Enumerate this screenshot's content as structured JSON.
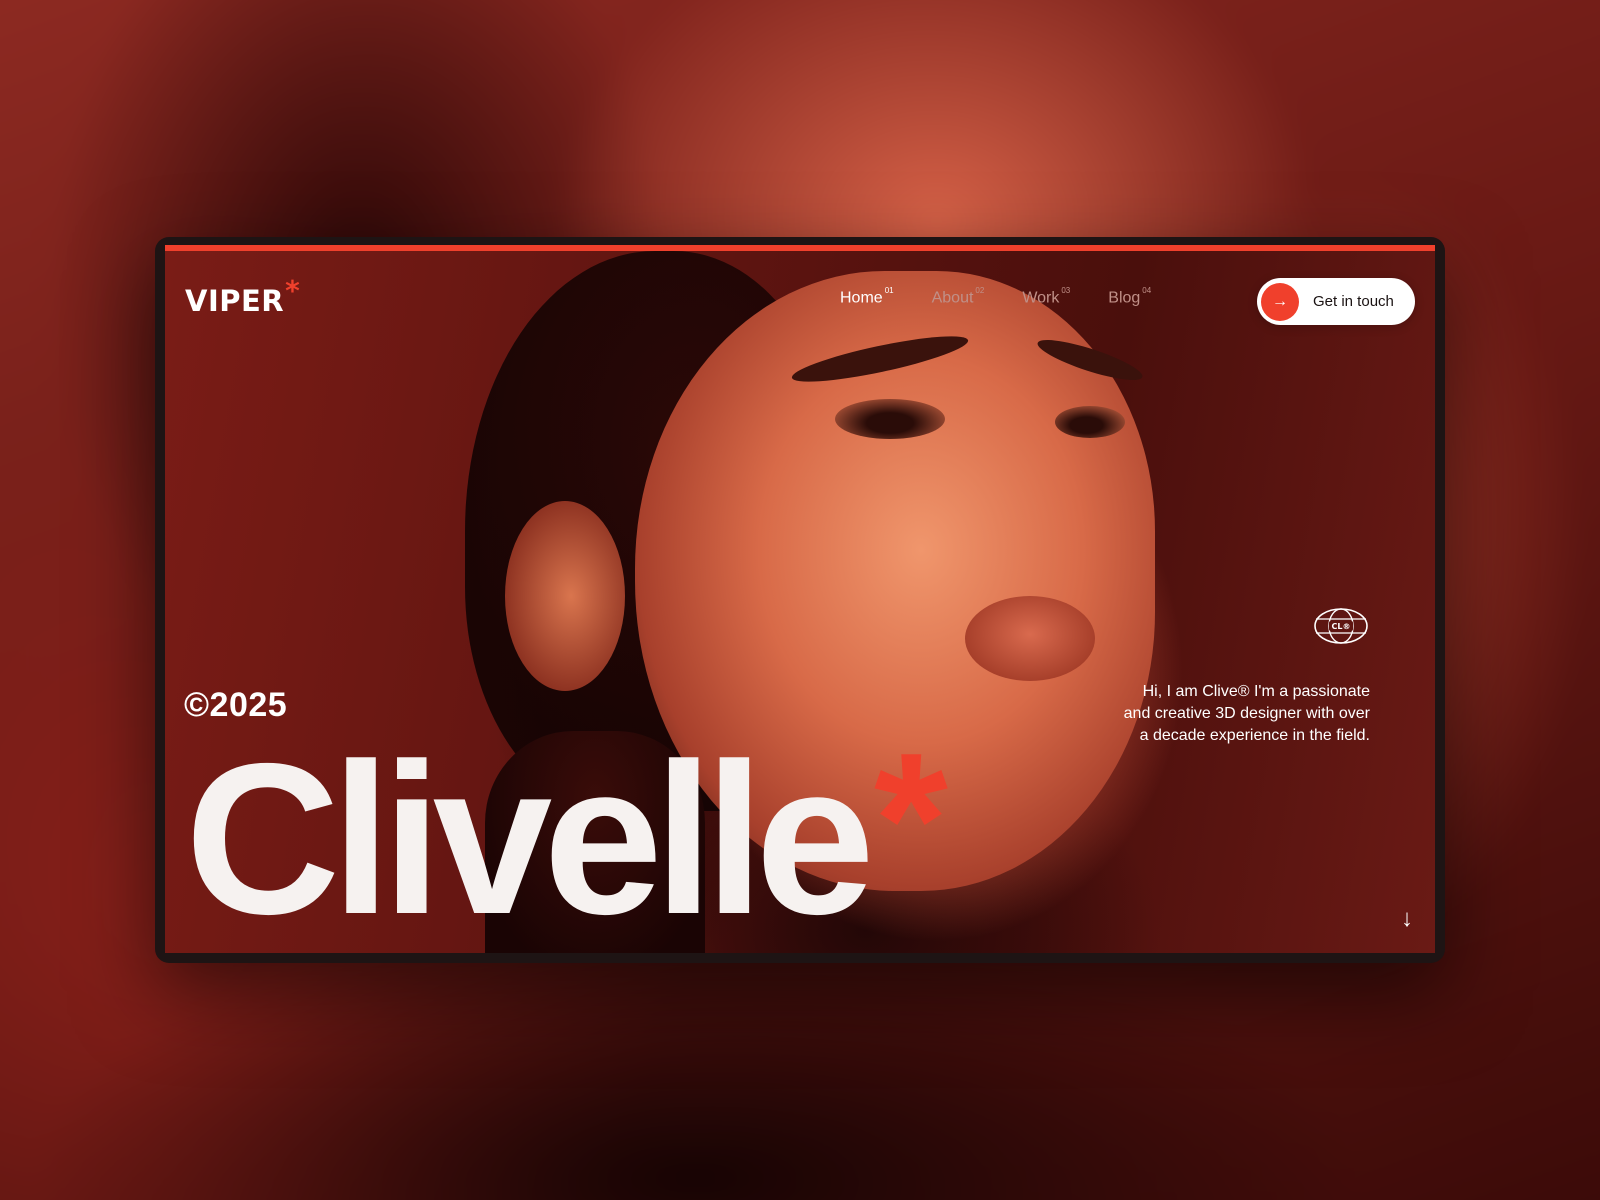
{
  "brand": {
    "name": "VIPER",
    "mark": "*",
    "accent_color": "#f0402c"
  },
  "nav": {
    "items": [
      {
        "label": "Home",
        "index": "01",
        "active": true
      },
      {
        "label": "About",
        "index": "02",
        "active": false
      },
      {
        "label": "Work",
        "index": "03",
        "active": false
      },
      {
        "label": "Blog",
        "index": "04",
        "active": false
      }
    ],
    "cta_label": "Get in touch",
    "cta_icon": "arrow-right-icon"
  },
  "hero": {
    "year": "©2025",
    "title": "Clivelle",
    "title_mark": "*",
    "bio": "Hi, I am Clive® I'm a passionate and creative 3D designer with over a decade experience in the field.",
    "badge_text": "CL®",
    "badge_icon": "globe-icon",
    "scroll_icon": "arrow-down-icon"
  }
}
